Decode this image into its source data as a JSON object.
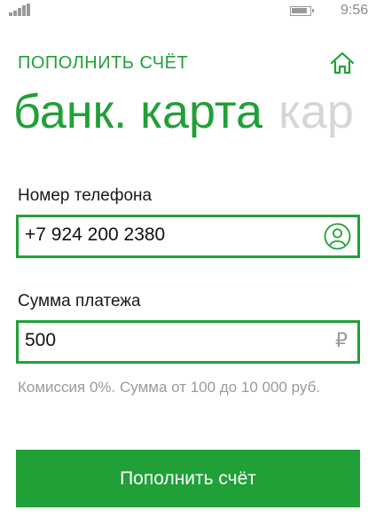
{
  "status_bar": {
    "time": "9:56",
    "signal_icon": "signal-strength-icon",
    "battery_icon": "battery-icon"
  },
  "header": {
    "section_title": "ПОПОЛНИТЬ СЧЁТ",
    "home_icon": "home-icon"
  },
  "pivot": {
    "active": "банк. карта",
    "next": "кар"
  },
  "form": {
    "phone": {
      "label": "Номер телефона",
      "value": "+7 924 200 2380",
      "icon": "contact-person-icon"
    },
    "amount": {
      "label": "Сумма платежа",
      "value": "500",
      "currency": "₽"
    },
    "hint": "Комиссия 0%. Сумма от 100 до 10 000 руб."
  },
  "submit": {
    "label": "Пополнить счёт"
  },
  "colors": {
    "accent": "#21a038",
    "muted": "#9a9a9a",
    "inactive_pivot": "#d6d6d6"
  }
}
